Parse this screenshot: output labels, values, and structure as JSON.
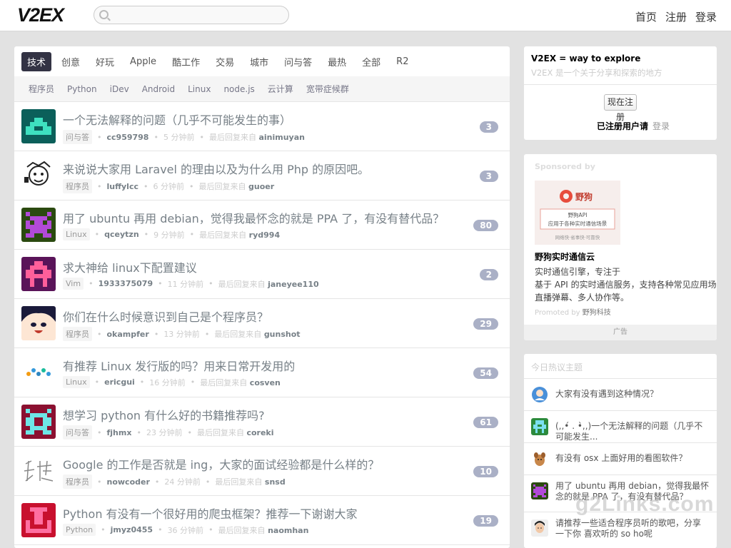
{
  "brand": {
    "logo": "V2EX"
  },
  "search": {
    "placeholder": ""
  },
  "topnav": {
    "items": [
      "首页",
      "注册",
      "登录"
    ]
  },
  "tabs": {
    "items": [
      "技术",
      "创意",
      "好玩",
      "Apple",
      "酷工作",
      "交易",
      "城市",
      "问与答",
      "最热",
      "全部",
      "R2"
    ],
    "active": "技术"
  },
  "subtabs": {
    "items": [
      "程序员",
      "Python",
      "iDev",
      "Android",
      "Linux",
      "node.js",
      "云计算",
      "宽带症候群"
    ]
  },
  "topics": [
    {
      "title": "一个无法解释的问题（几乎不可能发生的事）",
      "node": "问与答",
      "author": "cc959798",
      "time": "5 分钟前",
      "last_label": "最后回复来自",
      "last_user": "ainimuyan",
      "replies": "3"
    },
    {
      "title": "来说说大家用 Laravel 的理由以及为什么用 Php 的原因吧。",
      "node": "程序员",
      "author": "luffylcc",
      "time": "6 分钟前",
      "last_label": "最后回复来自",
      "last_user": "guoer",
      "replies": "3"
    },
    {
      "title": "用了 ubuntu 再用 debian，觉得我最怀念的就是 PPA 了，有没有替代品？",
      "node": "Linux",
      "author": "qceytzn",
      "time": "9 分钟前",
      "last_label": "最后回复来自",
      "last_user": "ryd994",
      "replies": "80"
    },
    {
      "title": "求大神给 linux下配置建议",
      "node": "Vim",
      "author": "1933375079",
      "time": "11 分钟前",
      "last_label": "最后回复来自",
      "last_user": "janeyee110",
      "replies": "2"
    },
    {
      "title": "你们在什么时候意识到自己是个程序员？",
      "node": "程序员",
      "author": "okampfer",
      "time": "13 分钟前",
      "last_label": "最后回复来自",
      "last_user": "gunshot",
      "replies": "29"
    },
    {
      "title": "有推荐 Linux 发行版的吗？用来日常开发用的",
      "node": "Linux",
      "author": "ericgui",
      "time": "16 分钟前",
      "last_label": "最后回复来自",
      "last_user": "cosven",
      "replies": "54"
    },
    {
      "title": "想学习 python 有什么好的书籍推荐吗?",
      "node": "问与答",
      "author": "fjhmx",
      "time": "23 分钟前",
      "last_label": "最后回复来自",
      "last_user": "coreki",
      "replies": "61"
    },
    {
      "title": "Google 的工作是否就是 ing，大家的面试经验都是什么样的？",
      "node": "程序员",
      "author": "nowcoder",
      "time": "24 分钟前",
      "last_label": "最后回复来自",
      "last_user": "snsd",
      "replies": "10"
    },
    {
      "title": "Python 有没有一个很好用的爬虫框架？推荐一下谢谢大家",
      "node": "Python",
      "author": "jmyz0455",
      "time": "36 分钟前",
      "last_label": "最后回复来自",
      "last_user": "naomhan",
      "replies": "19"
    }
  ],
  "intro": {
    "slogan": "V2EX = way to explore",
    "desc": "V2EX 是一个关于分享和探索的地方",
    "register_label": "现在注册",
    "login_prefix": "已注册用户请",
    "login_link": "登录"
  },
  "ad": {
    "sponsored_label": "Sponsored by",
    "image_caption_1": "野狗API",
    "image_caption_2": "应用于各种实时通信场景",
    "image_slogan": "网络快·省事快·可靠快",
    "brand": "野狗",
    "title": "野狗实时通信云",
    "line1": "实时通信引擎，专注于",
    "line2": "基于 API 的实时通信服务，支持各种常见应用场景，如聊天、",
    "line3": "直播弹幕、多人协作等。",
    "promoted_prefix": "Promoted by",
    "promoted_by": "野狗科技",
    "footer": "广告"
  },
  "hot": {
    "title": "今日热议主题",
    "items": [
      "大家有没有遇到这种情况？",
      "(,,•́ . •̀,,)一个无法解释的问题（几乎不可能发生...",
      "有没有 osx 上面好用的看图软件？",
      "用了 ubuntu 再用 debian，觉得我最怀念的就是 PPA 了，有没有替代品？",
      "请推荐一些适合程序员听的歌吧，分享 一下你 喜欢听的 so ho呢"
    ]
  },
  "watermark": "g2Links.com",
  "colors": {
    "active_tab": "#334455",
    "count_badge": "#aab0c6",
    "link_gray": "#778087"
  }
}
